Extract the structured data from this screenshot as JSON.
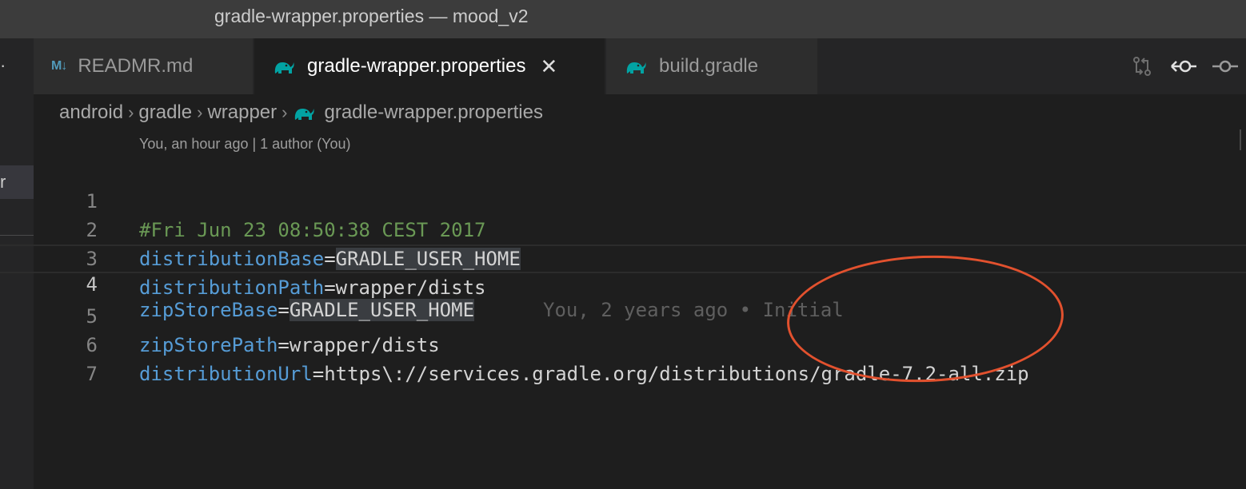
{
  "window": {
    "title": "gradle-wrapper.properties — mood_v2"
  },
  "sidebar": {
    "dots": "·",
    "selected_fragment": "r"
  },
  "tabs": [
    {
      "label": "READMR.md",
      "icon": "markdown-icon",
      "icon_text": "M↓",
      "active": false
    },
    {
      "label": "gradle-wrapper.properties",
      "icon": "gradle-elephant-icon",
      "active": true,
      "close": "✕"
    },
    {
      "label": "build.gradle",
      "icon": "gradle-elephant-icon",
      "active": false
    }
  ],
  "editor_actions": [
    "compare-changes-icon",
    "git-previous-change-icon",
    "git-next-change-icon"
  ],
  "breadcrumb": [
    "android",
    "gradle",
    "wrapper",
    "gradle-wrapper.properties"
  ],
  "breadcrumb_separator": "›",
  "codelens": "You, an hour ago | 1 author (You)",
  "lines": [
    {
      "n": "1",
      "comment": "#Fri Jun 23 08:50:38 CEST 2017"
    },
    {
      "n": "2",
      "key": "distributionBase",
      "eq": "=",
      "value": "GRADLE_USER_HOME"
    },
    {
      "n": "3",
      "key": "distributionPath",
      "eq": "=",
      "value": "wrapper/dists"
    },
    {
      "n": "4",
      "key": "zipStoreBase",
      "eq": "=",
      "value": "GRADLE_USER_HOME",
      "blame": "You, 2 years ago • Initial"
    },
    {
      "n": "5",
      "key": "zipStorePath",
      "eq": "=",
      "value": "wrapper/dists"
    },
    {
      "n": "6",
      "key": "distributionUrl",
      "eq": "=",
      "value": "https\\://services.gradle.org/distributions/gradle-7.2-all.zip"
    },
    {
      "n": "7"
    }
  ],
  "colors": {
    "comment": "#6a9955",
    "key": "#569cd6",
    "annotation": "#e2512e"
  }
}
